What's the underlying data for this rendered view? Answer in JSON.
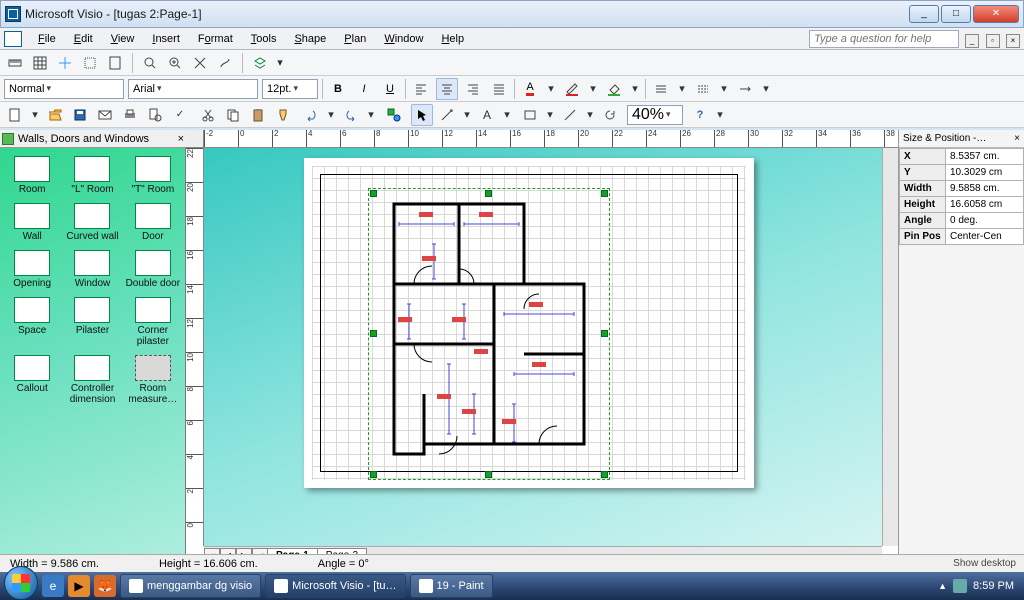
{
  "window": {
    "title": "Microsoft Visio - [tugas 2:Page-1]"
  },
  "menu": [
    "File",
    "Edit",
    "View",
    "Insert",
    "Format",
    "Tools",
    "Shape",
    "Plan",
    "Window",
    "Help"
  ],
  "help_placeholder": "Type a question for help",
  "format": {
    "style": "Normal",
    "font": "Arial",
    "size": "12pt.",
    "zoom": "40%"
  },
  "stencil": {
    "title": "Walls, Doors and Windows",
    "items": [
      {
        "label": "Room"
      },
      {
        "label": "\"L\" Room"
      },
      {
        "label": "\"T\" Room"
      },
      {
        "label": "Wall"
      },
      {
        "label": "Curved wall"
      },
      {
        "label": "Door"
      },
      {
        "label": "Opening"
      },
      {
        "label": "Window"
      },
      {
        "label": "Double door"
      },
      {
        "label": "Space"
      },
      {
        "label": "Pilaster"
      },
      {
        "label": "Corner pilaster"
      },
      {
        "label": "Callout"
      },
      {
        "label": "Controller dimension"
      },
      {
        "label": "Room measure…",
        "sel": true
      }
    ]
  },
  "sizepos": {
    "title": "Size & Position -…",
    "rows": [
      {
        "k": "X",
        "v": "8.5357 cm."
      },
      {
        "k": "Y",
        "v": "10.3029 cm"
      },
      {
        "k": "Width",
        "v": "9.5858 cm."
      },
      {
        "k": "Height",
        "v": "16.6058 cm"
      },
      {
        "k": "Angle",
        "v": "0 deg."
      },
      {
        "k": "Pin Pos",
        "v": "Center-Cen"
      }
    ]
  },
  "ruler_h": [
    "-2",
    "0",
    "2",
    "4",
    "6",
    "8",
    "10",
    "12",
    "14",
    "16",
    "18",
    "20",
    "22",
    "24",
    "26",
    "28",
    "30",
    "32",
    "34",
    "36",
    "38"
  ],
  "ruler_v": [
    "22",
    "20",
    "18",
    "16",
    "14",
    "12",
    "10",
    "8",
    "6",
    "4",
    "2",
    "0"
  ],
  "tabs": [
    {
      "label": "Page-1",
      "active": true
    },
    {
      "label": "Page-2"
    }
  ],
  "status": {
    "width": "Width = 9.586 cm.",
    "height": "Height = 16.606 cm.",
    "angle": "Angle = 0°",
    "showdesk": "Show desktop"
  },
  "taskbar": {
    "items": [
      {
        "label": "menggambar dg visio"
      },
      {
        "label": "Microsoft Visio - [tu…",
        "active": true
      },
      {
        "label": "19 - Paint"
      }
    ],
    "time": "8:59 PM"
  }
}
